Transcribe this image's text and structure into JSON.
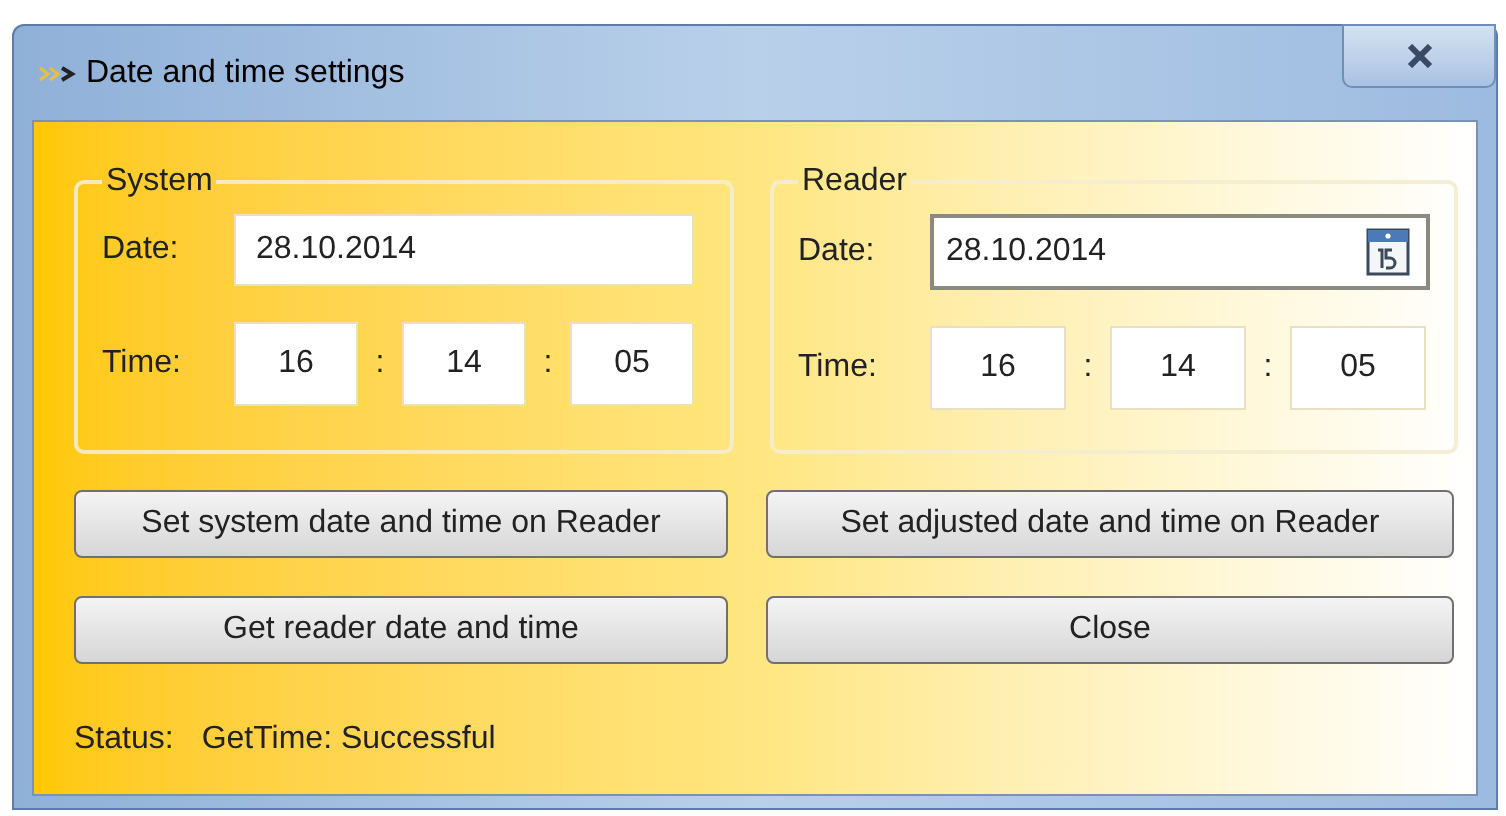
{
  "window": {
    "title": "Date and time settings"
  },
  "groups": [
    {
      "title": "System",
      "kind": "plain",
      "date_label": "Date:",
      "date": "28.10.2014",
      "time_label": "Time:",
      "time": [
        "16",
        "14",
        "05"
      ],
      "separators": [
        ":",
        ":"
      ]
    },
    {
      "title": "Reader",
      "kind": "picker",
      "date_label": "Date:",
      "date": "28.10.2014",
      "time_label": "Time:",
      "time": [
        "16",
        "14",
        "05"
      ],
      "separators": [
        ":",
        ":"
      ]
    }
  ],
  "buttons": [
    "Set system date and time on Reader",
    "Set adjusted date and time on Reader",
    "Get reader date and time",
    "Close"
  ],
  "status": {
    "label": "Status:",
    "value": "GetTime: Successful"
  }
}
